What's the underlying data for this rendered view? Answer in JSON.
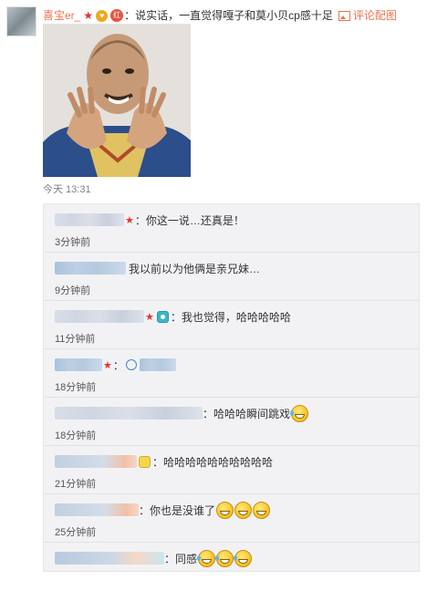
{
  "post": {
    "username": "喜宝er_",
    "badge_star": "★",
    "badge_heart": "♥",
    "badge_red": "红",
    "colon": "：",
    "text": "说实话，一直觉得嘎子和莫小贝cp感十足",
    "see_image_label": "评论配图",
    "timestamp": "今天 13:31"
  },
  "replies": [
    {
      "text": "：你这一说…还真是！",
      "time": "3分钟前",
      "emoji_count": 0
    },
    {
      "text": "我以前以为他俩是亲兄妹…",
      "time": "9分钟前",
      "emoji_count": 0
    },
    {
      "text": "：我也觉得，哈哈哈哈哈",
      "time": "11分钟前",
      "emoji_count": 0
    },
    {
      "text": "：",
      "time": "18分钟前",
      "emoji_count": 0
    },
    {
      "text": "：哈哈哈瞬间跳戏",
      "time": "18分钟前",
      "emoji_count": 1
    },
    {
      "text": "：哈哈哈哈哈哈哈哈哈哈",
      "time": "21分钟前",
      "emoji_count": 0
    },
    {
      "text": "：你也是没谁了",
      "time": "25分钟前",
      "emoji_count": 3
    },
    {
      "text": "：同感",
      "time": "",
      "emoji_count": 3
    }
  ],
  "icons": {
    "see_image": "picture-icon",
    "emoji_grin": "grin-emoji-icon",
    "emoji_laugh_cry": "laugh-cry-emoji-icon"
  },
  "colors": {
    "username": "#eb7350",
    "link": "#eb7350",
    "reply_bg": "#f2f2f5"
  }
}
